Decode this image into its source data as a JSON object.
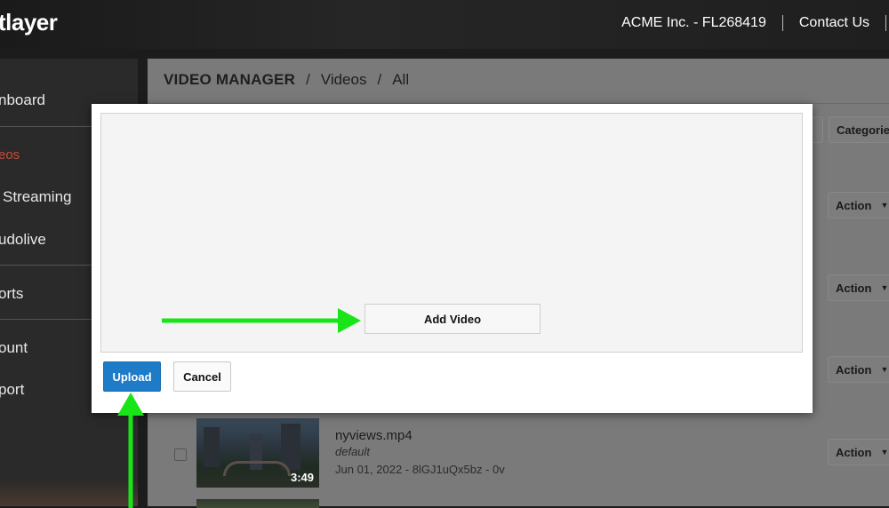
{
  "header": {
    "brand": "tlayer",
    "account": "ACME Inc. - FL268419",
    "contact": "Contact Us"
  },
  "sidebar": {
    "items": [
      {
        "label": "nboard"
      },
      {
        "label": "eos"
      },
      {
        "label": "Streaming"
      },
      {
        "label": "udolive"
      },
      {
        "label": "orts"
      },
      {
        "label": "ount"
      },
      {
        "label": "port"
      }
    ]
  },
  "main": {
    "breadcrumb": {
      "title": "VIDEO MANAGER",
      "sep": "/",
      "crumb1": "Videos",
      "crumb2": "All"
    },
    "filters": {
      "categories": "Categories"
    },
    "action_label": "Action",
    "video": {
      "title": "nyviews.mp4",
      "subtitle": "default",
      "meta": "Jun 01, 2022 - 8lGJ1uQx5bz - 0v",
      "duration": "3:49"
    }
  },
  "modal": {
    "add_video": "Add Video",
    "upload": "Upload",
    "cancel": "Cancel"
  },
  "colors": {
    "primary": "#1e7bc8",
    "annotation_arrow": "#18e418",
    "active_nav": "#c84c3a"
  }
}
